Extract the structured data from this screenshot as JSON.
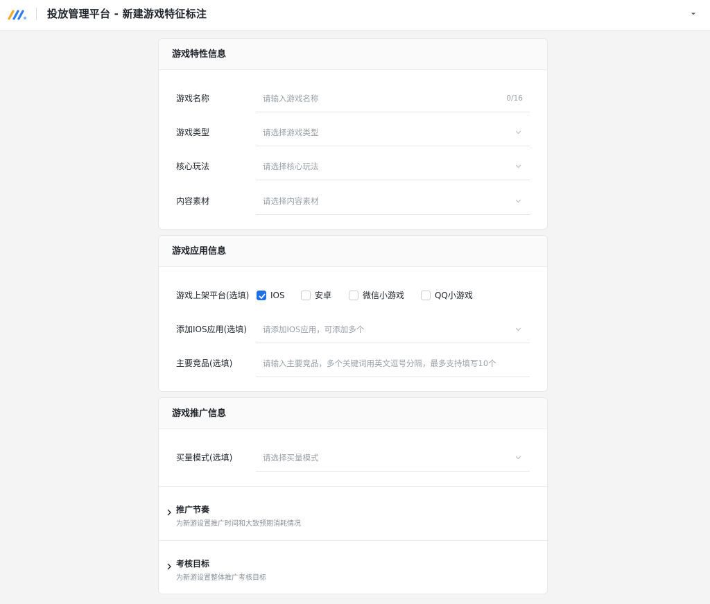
{
  "header": {
    "title": "投放管理平台 - 新建游戏特征标注",
    "logo_icon": "brand-logo-icon",
    "menu_icon": "caret-down-icon"
  },
  "section1": {
    "title": "游戏特性信息",
    "fields": [
      {
        "label": "游戏名称",
        "placeholder": "请输入游戏名称",
        "counter": "0/16",
        "type": "text"
      },
      {
        "label": "游戏类型",
        "placeholder": "请选择游戏类型",
        "type": "select"
      },
      {
        "label": "核心玩法",
        "placeholder": "请选择核心玩法",
        "type": "select"
      },
      {
        "label": "内容素材",
        "placeholder": "请选择内容素材",
        "type": "select"
      }
    ]
  },
  "section2": {
    "title": "游戏应用信息",
    "platform": {
      "label": "游戏上架平台(选填)",
      "options": [
        {
          "label": "IOS",
          "checked": true
        },
        {
          "label": "安卓",
          "checked": false
        },
        {
          "label": "微信小游戏",
          "checked": false
        },
        {
          "label": "QQ小游戏",
          "checked": false
        }
      ]
    },
    "ios_app": {
      "label": "添加IOS应用(选填)",
      "placeholder": "请添加IOS应用，可添加多个"
    },
    "competitor": {
      "label": "主要竞品(选填)",
      "placeholder": "请输入主要竞品，多个关键词用英文逗号分隔，最多支持填写10个"
    }
  },
  "section3": {
    "title": "游戏推广信息",
    "buy_mode": {
      "label": "买量模式(选填)",
      "placeholder": "请选择买量模式"
    },
    "panels": [
      {
        "title": "推广节奏",
        "desc": "为新游设置推广时间和大致预期消耗情况"
      },
      {
        "title": "考核目标",
        "desc": "为新游设置整体推广考核目标"
      }
    ]
  },
  "colors": {
    "accent": "#1f6fe5",
    "background": "#f4f4f5",
    "placeholder": "#9aa0a6"
  }
}
